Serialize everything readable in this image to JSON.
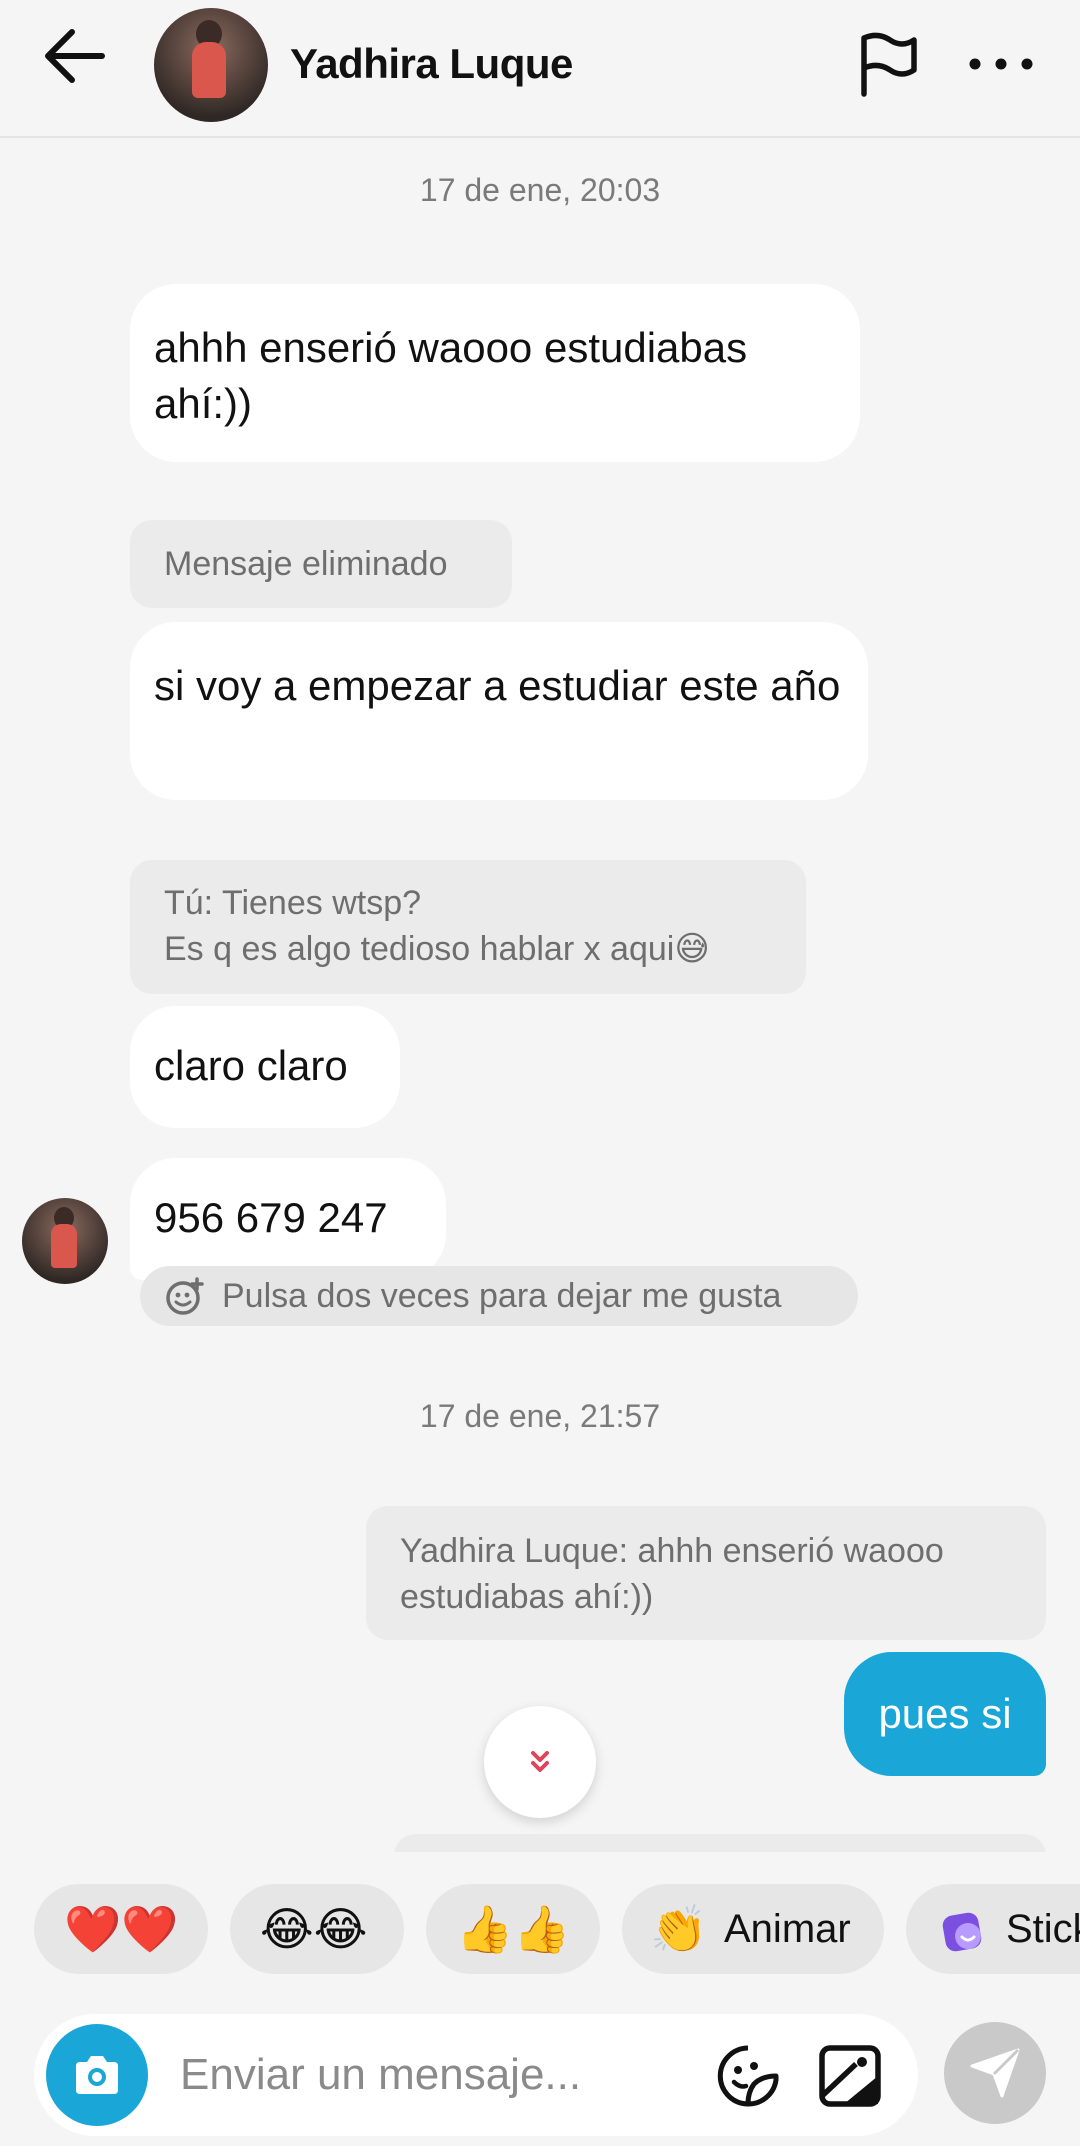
{
  "header": {
    "contact_name": "Yadhira Luque",
    "back_icon": "arrow-left-icon",
    "flag_icon": "flag-icon",
    "more_icon": "more-horizontal-icon"
  },
  "conversation": {
    "timestamp_1": "17 de ene, 20:03",
    "msg_1": "ahhh enserió waooo estudiabas ahí:))",
    "deleted_label": "Mensaje eliminado",
    "msg_2": "si voy a empezar a estudiar este año",
    "quote_1_line1": "Tú: Tienes wtsp?",
    "quote_1_line2": "Es q es algo tedioso hablar x aqui😅",
    "msg_3": "claro claro",
    "msg_4": "956 679 247",
    "like_hint": "Pulsa dos veces para dejar me gusta",
    "timestamp_2": "17 de ene, 21:57",
    "quote_2": "Yadhira Luque: ahhh enserió waooo estudiabas ahí:))",
    "msg_out_1": "pues si"
  },
  "quick_reactions": [
    {
      "emoji": "❤️❤️",
      "label": ""
    },
    {
      "emoji": "😂😂",
      "label": ""
    },
    {
      "emoji": "👍👍",
      "label": ""
    },
    {
      "emoji": "👏",
      "label": "Animar"
    },
    {
      "emoji": "🟣",
      "label": "Stick"
    }
  ],
  "composer": {
    "placeholder": "Enviar un mensaje..."
  },
  "colors": {
    "accent": "#1aa6d6",
    "background": "#f5f5f5",
    "bubble_in": "#ffffff",
    "quote_bg": "#ebebeb"
  }
}
